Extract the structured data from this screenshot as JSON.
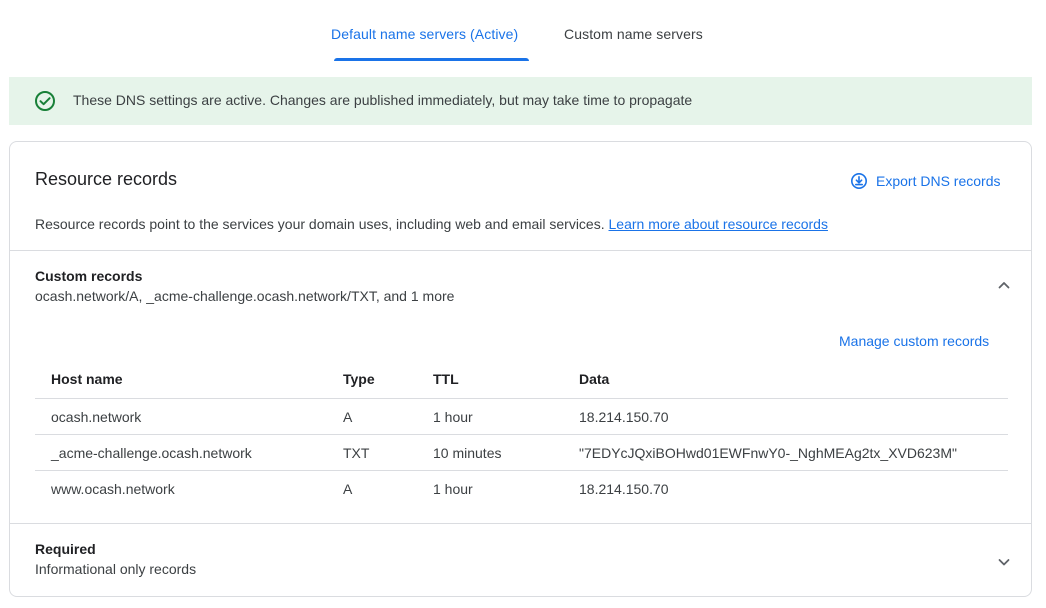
{
  "tabs": {
    "active_label": "Default name servers (Active)",
    "inactive_label": "Custom name servers"
  },
  "banner": {
    "icon": "check-circle-icon",
    "text": "These DNS settings are active. Changes are published immediately, but may take time to propagate"
  },
  "resource_records": {
    "title": "Resource records",
    "export_label": "Export DNS records",
    "export_icon": "download-circle-icon",
    "description": "Resource records point to the services your domain uses, including web and email services.",
    "learn_more_label": "Learn more about resource records"
  },
  "custom_records": {
    "title": "Custom records",
    "summary": "ocash.network/A, _acme-challenge.ocash.network/TXT, and 1 more",
    "expanded": true,
    "manage_label": "Manage custom records",
    "columns": [
      "Host name",
      "Type",
      "TTL",
      "Data"
    ],
    "rows": [
      [
        "ocash.network",
        "A",
        "1 hour",
        "18.214.150.70"
      ],
      [
        "_acme-challenge.ocash.network",
        "TXT",
        "10 minutes",
        "\"7EDYcJQxiBOHwd01EWFnwY0-_NghMEAg2tx_XVD623M\""
      ],
      [
        "www.ocash.network",
        "A",
        "1 hour",
        "18.214.150.70"
      ]
    ]
  },
  "required": {
    "title": "Required",
    "summary": "Informational only records",
    "expanded": false
  },
  "colors": {
    "accent": "#1a73e8",
    "success": "#188038",
    "banner_bg": "#e6f4ea"
  }
}
